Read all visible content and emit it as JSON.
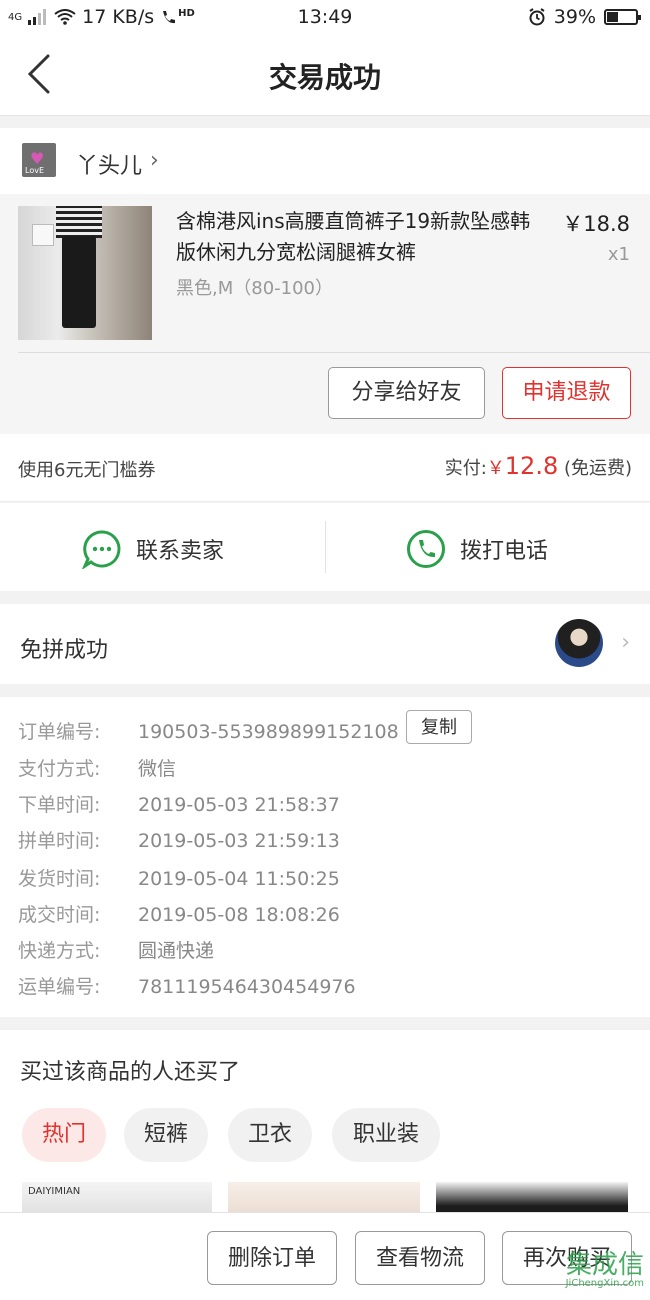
{
  "status_bar": {
    "network": "4G",
    "speed": "17 KB/s",
    "hd": "HD",
    "time": "13:49",
    "battery": "39%"
  },
  "nav": {
    "title": "交易成功"
  },
  "shop": {
    "name": "丫头儿",
    "logo_text": "LovE"
  },
  "item": {
    "title": "含棉港风ins高腰直筒裤子19新款坠感韩版休闲九分宽松阔腿裤女裤",
    "spec": "黑色,M（80-100）",
    "price": "￥18.8",
    "qty": "x1",
    "share_label": "分享给好友",
    "refund_label": "申请退款"
  },
  "payment": {
    "coupon": "使用6元无门槛券",
    "paid_label": "实付:",
    "currency": "￥",
    "amount": "12.8",
    "shipping": "(免运费)"
  },
  "contact": {
    "seller_label": "联系卖家",
    "call_label": "拨打电话"
  },
  "group": {
    "label": "免拼成功"
  },
  "details": {
    "copy_label": "复制",
    "rows": [
      {
        "label": "订单编号:",
        "value": "190503-553989899152108"
      },
      {
        "label": "支付方式:",
        "value": "微信"
      },
      {
        "label": "下单时间:",
        "value": "2019-05-03 21:58:37"
      },
      {
        "label": "拼单时间:",
        "value": "2019-05-03 21:59:13"
      },
      {
        "label": "发货时间:",
        "value": "2019-05-04 11:50:25"
      },
      {
        "label": "成交时间:",
        "value": "2019-05-08 18:08:26"
      },
      {
        "label": "快递方式:",
        "value": "圆通快递"
      },
      {
        "label": "运单编号:",
        "value": "781119546430454976"
      }
    ]
  },
  "recommend": {
    "title": "买过该商品的人还买了",
    "chips": [
      "热门",
      "短裤",
      "卫衣",
      "职业装"
    ],
    "brand_text": "DAIYIMIAN"
  },
  "bottom": {
    "delete_label": "删除订单",
    "logistics_label": "查看物流",
    "rebuy_label": "再次购买"
  },
  "watermark": {
    "main": "集成信",
    "sub": "JiChengXin.com"
  },
  "colors": {
    "accent": "#e0322e",
    "green": "#2aa04a"
  }
}
